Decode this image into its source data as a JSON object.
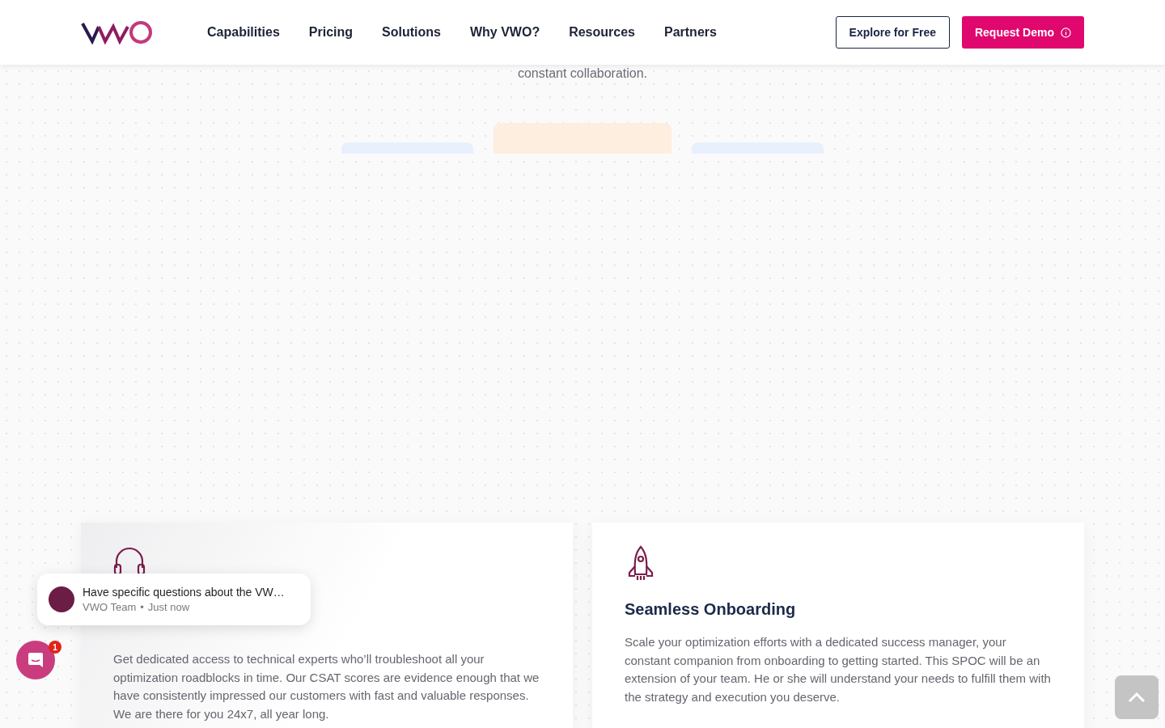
{
  "header": {
    "nav": [
      {
        "label": "Capabilities"
      },
      {
        "label": "Pricing"
      },
      {
        "label": "Solutions"
      },
      {
        "label": "Why VWO?"
      },
      {
        "label": "Resources"
      },
      {
        "label": "Partners"
      }
    ],
    "buttons": [
      {
        "label": "Explore for Free",
        "kind": "outline"
      },
      {
        "label": "Request Demo",
        "kind": "primary"
      }
    ]
  },
  "intro_text": "constant collaboration.",
  "tabs": [
    {
      "color": "#e8f0fd",
      "selected": false
    },
    {
      "color": "#fdeee0",
      "selected": true
    },
    {
      "color": "#e8f0fd",
      "selected": false
    }
  ],
  "cards": [
    {
      "kind": "headset",
      "description": "Get dedicated access to technical experts who’ll troubleshoot all your optimization roadblocks in time. Our CSAT scores are evidence enough that we have consistently impressed our customers with fast and valuable responses. We are there for you 24x7, all year long."
    },
    {
      "kind": "rocket",
      "title": "Seamless Onboarding",
      "description": "Scale your optimization efforts with a dedicated success manager, your constant companion from onboarding to getting started. This SPOC will be an extension of your team. He or she will understand your needs to fulfill them with the strategy and execution you deserve."
    }
  ],
  "chat": {
    "message": "Have specific questions about the VW…",
    "author": "VWO Team",
    "separator": "•",
    "time": "Just now",
    "unread": "1"
  }
}
